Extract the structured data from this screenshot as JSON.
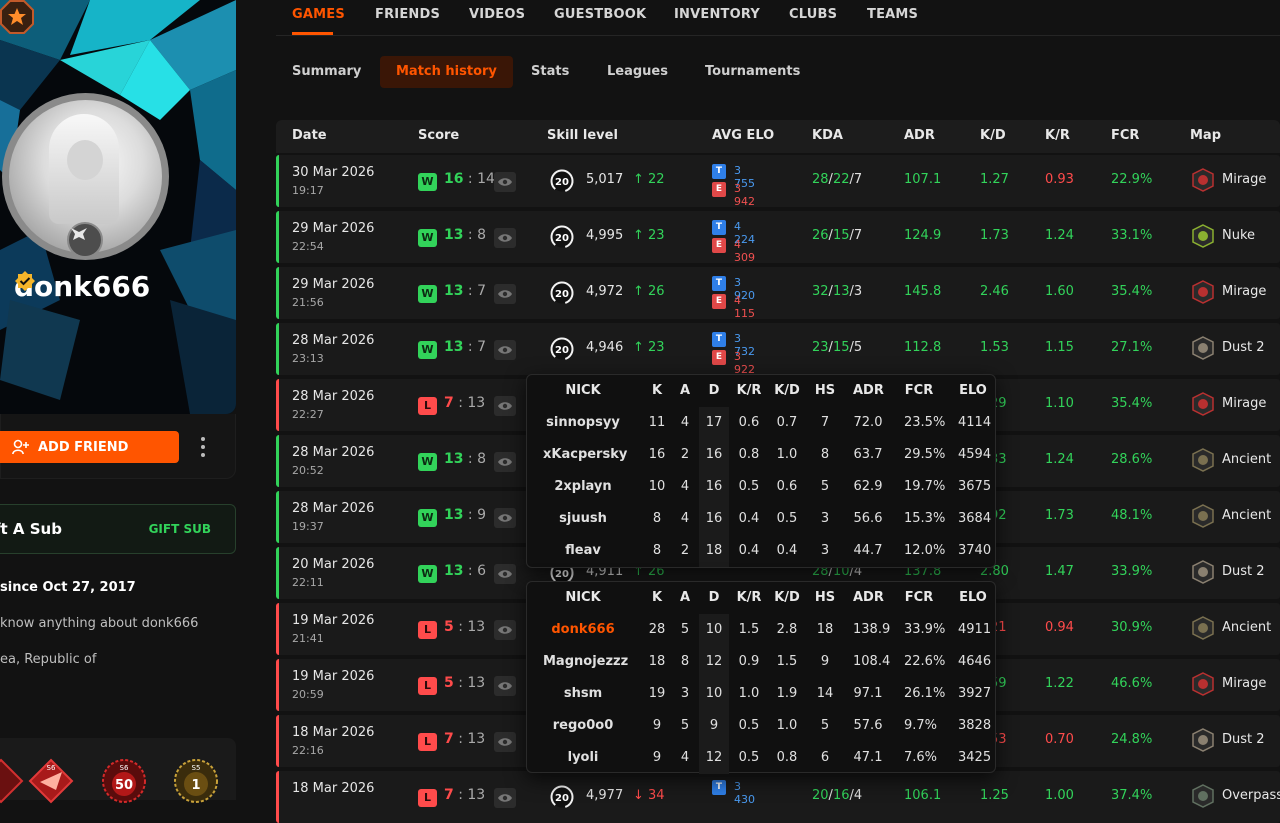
{
  "profile": {
    "username": "donk666",
    "add_friend_label": "ADD FRIEND",
    "gift_title": "ft A Sub",
    "gift_button": "GIFT SUB",
    "member_since": "since Oct 27, 2017",
    "about_text": "know anything about donk666",
    "country": "ea, Republic of",
    "medals": [
      {
        "icon": "diamond-medal-icon",
        "label": ""
      },
      {
        "icon": "wing-medal-icon",
        "label": "S6"
      },
      {
        "icon": "laurel-medal-icon",
        "label": "50",
        "sub": "S6"
      },
      {
        "icon": "gold-laurel-medal-icon",
        "label": "1",
        "sub": "S5"
      }
    ]
  },
  "top_tabs": [
    "GAMES",
    "FRIENDS",
    "VIDEOS",
    "GUESTBOOK",
    "INVENTORY",
    "CLUBS",
    "TEAMS"
  ],
  "sub_tabs": [
    "Summary",
    "Match history",
    "Stats",
    "Leagues",
    "Tournaments"
  ],
  "columns": [
    "Date",
    "Score",
    "Skill level",
    "AVG ELO",
    "KDA",
    "ADR",
    "K/D",
    "K/R",
    "FCR",
    "Map"
  ],
  "colors": {
    "accent": "#ff5500",
    "win": "#32d35a",
    "loss": "#ff4b4b",
    "team_t": "#2f7fe8",
    "team_e": "#e04848"
  },
  "skill_level": "20",
  "matches": [
    {
      "date": "30 Mar 2026",
      "time": "19:17",
      "result": "W",
      "score_own": "16",
      "score_opp": "14",
      "elo": "5,017",
      "delta": "22",
      "delta_dir": "up",
      "t": "3 755",
      "e": "3 942",
      "k": "28",
      "d": "22",
      "a": "7",
      "adr": "107.1",
      "kd": "1.27",
      "kr": "0.93",
      "fcr": "22.9%",
      "map": "Mirage"
    },
    {
      "date": "29 Mar 2026",
      "time": "22:54",
      "result": "W",
      "score_own": "13",
      "score_opp": "8",
      "elo": "4,995",
      "delta": "23",
      "delta_dir": "up",
      "t": "4 224",
      "e": "4 309",
      "k": "26",
      "d": "15",
      "a": "7",
      "adr": "124.9",
      "kd": "1.73",
      "kr": "1.24",
      "fcr": "33.1%",
      "map": "Nuke"
    },
    {
      "date": "29 Mar 2026",
      "time": "21:56",
      "result": "W",
      "score_own": "13",
      "score_opp": "7",
      "elo": "4,972",
      "delta": "26",
      "delta_dir": "up",
      "t": "3 920",
      "e": "4 115",
      "k": "32",
      "d": "13",
      "a": "3",
      "adr": "145.8",
      "kd": "2.46",
      "kr": "1.60",
      "fcr": "35.4%",
      "map": "Mirage"
    },
    {
      "date": "28 Mar 2026",
      "time": "23:13",
      "result": "W",
      "score_own": "13",
      "score_opp": "7",
      "elo": "4,946",
      "delta": "23",
      "delta_dir": "up",
      "t": "3 732",
      "e": "3 922",
      "k": "23",
      "d": "15",
      "a": "5",
      "adr": "112.8",
      "kd": "1.53",
      "kr": "1.15",
      "fcr": "27.1%",
      "map": "Dust 2"
    },
    {
      "date": "28 Mar 2026",
      "time": "22:27",
      "result": "L",
      "score_own": "7",
      "score_opp": "13",
      "elo": "",
      "delta": "",
      "delta_dir": "",
      "t": "",
      "e": "",
      "k": "",
      "d": "",
      "a": "",
      "adr": "",
      "kd": "29",
      "kr": "1.10",
      "fcr": "35.4%",
      "map": "Mirage"
    },
    {
      "date": "28 Mar 2026",
      "time": "20:52",
      "result": "W",
      "score_own": "13",
      "score_opp": "8",
      "elo": "",
      "delta": "",
      "delta_dir": "",
      "t": "",
      "e": "",
      "k": "",
      "d": "",
      "a": "",
      "adr": "",
      "kd": "33",
      "kr": "1.24",
      "fcr": "28.6%",
      "map": "Ancient"
    },
    {
      "date": "28 Mar 2026",
      "time": "19:37",
      "result": "W",
      "score_own": "13",
      "score_opp": "9",
      "elo": "",
      "delta": "",
      "delta_dir": "",
      "t": "",
      "e": "",
      "k": "",
      "d": "",
      "a": "",
      "adr": "",
      "kd": "92",
      "kr": "1.73",
      "fcr": "48.1%",
      "map": "Ancient"
    },
    {
      "date": "20 Mar 2026",
      "time": "22:11",
      "result": "W",
      "score_own": "13",
      "score_opp": "6",
      "elo": "4,911",
      "delta": "26",
      "delta_dir": "up",
      "t": "",
      "e": "",
      "k": "28",
      "d": "10",
      "a": "4",
      "adr": "137.8",
      "kd": "2.80",
      "kr": "1.47",
      "fcr": "33.9%",
      "map": "Dust 2"
    },
    {
      "date": "19 Mar 2026",
      "time": "21:41",
      "result": "L",
      "score_own": "5",
      "score_opp": "13",
      "elo": "",
      "delta": "",
      "delta_dir": "",
      "t": "",
      "e": "",
      "k": "",
      "d": "",
      "a": "",
      "adr": "",
      "kd": "21",
      "kr": "0.94",
      "fcr": "30.9%",
      "map": "Ancient"
    },
    {
      "date": "19 Mar 2026",
      "time": "20:59",
      "result": "L",
      "score_own": "5",
      "score_opp": "13",
      "elo": "",
      "delta": "",
      "delta_dir": "",
      "t": "",
      "e": "",
      "k": "",
      "d": "",
      "a": "",
      "adr": "",
      "kd": "59",
      "kr": "1.22",
      "fcr": "46.6%",
      "map": "Mirage"
    },
    {
      "date": "18 Mar 2026",
      "time": "22:16",
      "result": "L",
      "score_own": "7",
      "score_opp": "13",
      "elo": "",
      "delta": "",
      "delta_dir": "",
      "t": "",
      "e": "",
      "k": "",
      "d": "",
      "a": "",
      "adr": "",
      "kd": "53",
      "kr": "0.70",
      "fcr": "24.8%",
      "map": "Dust 2"
    },
    {
      "date": "18 Mar 2026",
      "time": "",
      "result": "L",
      "score_own": "7",
      "score_opp": "13",
      "elo": "4,977",
      "delta": "34",
      "delta_dir": "down",
      "t": "3 430",
      "e": "",
      "k": "20",
      "d": "16",
      "a": "4",
      "adr": "106.1",
      "kd": "1.25",
      "kr": "1.00",
      "fcr": "37.4%",
      "map": "Overpass"
    }
  ],
  "popup_headers": [
    "NICK",
    "K",
    "A",
    "D",
    "K/R",
    "K/D",
    "HS",
    "ADR",
    "FCR",
    "ELO"
  ],
  "popup_team1": [
    [
      "sinnopsyy",
      "11",
      "4",
      "17",
      "0.6",
      "0.7",
      "7",
      "72.0",
      "23.5%",
      "4114"
    ],
    [
      "xKacpersky",
      "16",
      "2",
      "16",
      "0.8",
      "1.0",
      "8",
      "63.7",
      "29.5%",
      "4594"
    ],
    [
      "2xplayn",
      "10",
      "4",
      "16",
      "0.5",
      "0.6",
      "5",
      "62.9",
      "19.7%",
      "3675"
    ],
    [
      "sjuush",
      "8",
      "4",
      "16",
      "0.4",
      "0.5",
      "3",
      "56.6",
      "15.3%",
      "3684"
    ],
    [
      "fleav",
      "8",
      "2",
      "18",
      "0.4",
      "0.4",
      "3",
      "44.7",
      "12.0%",
      "3740"
    ]
  ],
  "popup_team2": [
    [
      "donk666",
      "28",
      "5",
      "10",
      "1.5",
      "2.8",
      "18",
      "138.9",
      "33.9%",
      "4911"
    ],
    [
      "Magnojezzz",
      "18",
      "8",
      "12",
      "0.9",
      "1.5",
      "9",
      "108.4",
      "22.6%",
      "4646"
    ],
    [
      "shsm",
      "19",
      "3",
      "10",
      "1.0",
      "1.9",
      "14",
      "97.1",
      "26.1%",
      "3927"
    ],
    [
      "rego0o0",
      "9",
      "5",
      "9",
      "0.5",
      "1.0",
      "5",
      "57.6",
      "9.7%",
      "3828"
    ],
    [
      "lyoli",
      "9",
      "4",
      "12",
      "0.5",
      "0.8",
      "6",
      "47.1",
      "7.6%",
      "3425"
    ]
  ]
}
